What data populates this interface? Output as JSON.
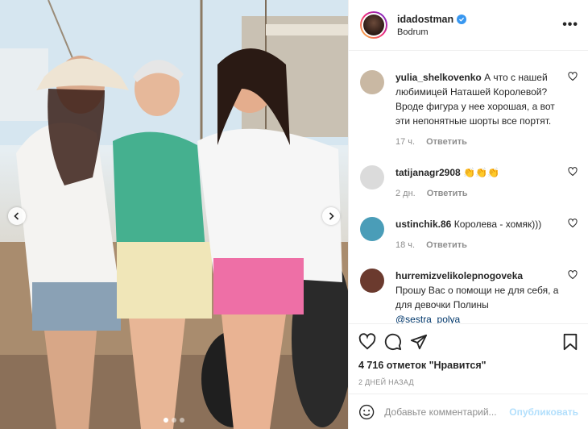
{
  "post": {
    "username": "idadostman",
    "location": "Bodrum",
    "more_label": "•••",
    "verified_icon": "verified-badge-icon"
  },
  "photo": {
    "description_icon": "photo",
    "carousel_count": 3,
    "active_index": 0
  },
  "comments": [
    {
      "username": "yulia_shelkovenko",
      "text": "А что с нашей любимицей Наташей Королевой? Вроде фигура у нее хорошая, а вот эти непонятные шорты все портят.",
      "time": "17 ч.",
      "reply": "Ответить",
      "avatar_color": "#c9b8a3"
    },
    {
      "username": "tatijanagr2908",
      "text": "👏👏👏",
      "time": "2 дн.",
      "reply": "Ответить",
      "avatar_color": "#dbdbdb"
    },
    {
      "username": "ustinchik.86",
      "text": "Королева - хомяк)))",
      "time": "18 ч.",
      "reply": "Ответить",
      "avatar_color": "#4a9db8"
    },
    {
      "username": "hurremizvelikolepnogoveka",
      "text": "Прошу Вас о помощи не для себя, а для девочки Полины",
      "mention": "@sestra_polya",
      "time": "",
      "reply": "",
      "avatar_color": "#6b3a2e"
    }
  ],
  "actions": {
    "likes_count": "4 716",
    "likes_text": "отметок \"Нравится\"",
    "date": "2 ДНЕЙ НАЗАД"
  },
  "add_comment": {
    "placeholder": "Добавьте комментарий...",
    "publish": "Опубликовать"
  }
}
